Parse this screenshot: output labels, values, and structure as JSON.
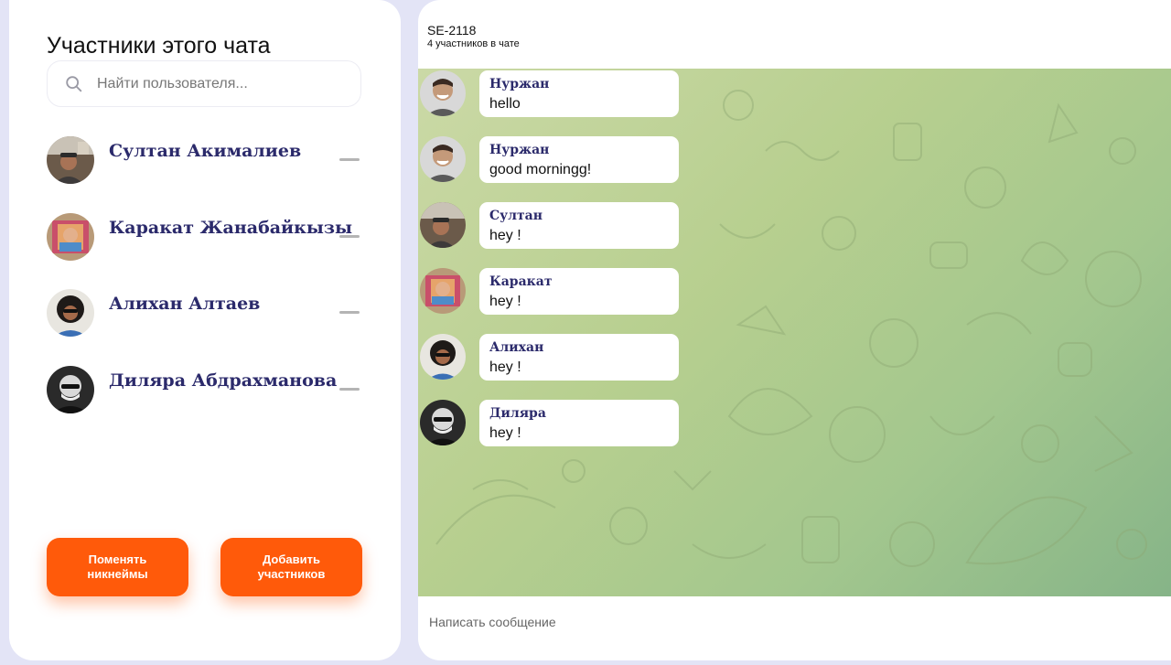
{
  "sidebar": {
    "title": "Участники этого чата",
    "search": {
      "placeholder": "Найти пользователя...",
      "value": ""
    },
    "members": [
      {
        "name": "Султан Акималиев",
        "avatar": "person-with-cap"
      },
      {
        "name": "Каракат Жанабайкызы",
        "avatar": "person-colorful"
      },
      {
        "name": "Алихан Алтаев",
        "avatar": "person-curly-hair-sunglasses"
      },
      {
        "name": "Диляра Абдрахманова",
        "avatar": "person-bald-glasses-bw"
      }
    ],
    "buttons": {
      "rename": "Поменять\nникнеймы",
      "add": "Добавить\nучастников"
    }
  },
  "chat": {
    "title": "SE-2118",
    "subtitle": "4 участников в чате",
    "messages": [
      {
        "sender": "Нуржан",
        "text": "hello",
        "avatar": "smiling-man"
      },
      {
        "sender": "Нуржан",
        "text": "good morningg!",
        "avatar": "smiling-man"
      },
      {
        "sender": "Султан",
        "text": "hey !",
        "avatar": "person-with-cap"
      },
      {
        "sender": "Каракат",
        "text": "hey !",
        "avatar": "person-colorful"
      },
      {
        "sender": "Алихан",
        "text": "hey !",
        "avatar": "person-curly-hair-sunglasses"
      },
      {
        "sender": "Диляра",
        "text": "hey !",
        "avatar": "person-bald-glasses-bw"
      }
    ],
    "compose": {
      "placeholder": "Написать сообщение",
      "value": ""
    }
  },
  "colors": {
    "accent": "#ff5a0a",
    "name_color": "#2b2a6b",
    "page_bg": "#e3e4f6",
    "chat_bg_start": "#cbd9a6",
    "chat_bg_end": "#86b488"
  }
}
